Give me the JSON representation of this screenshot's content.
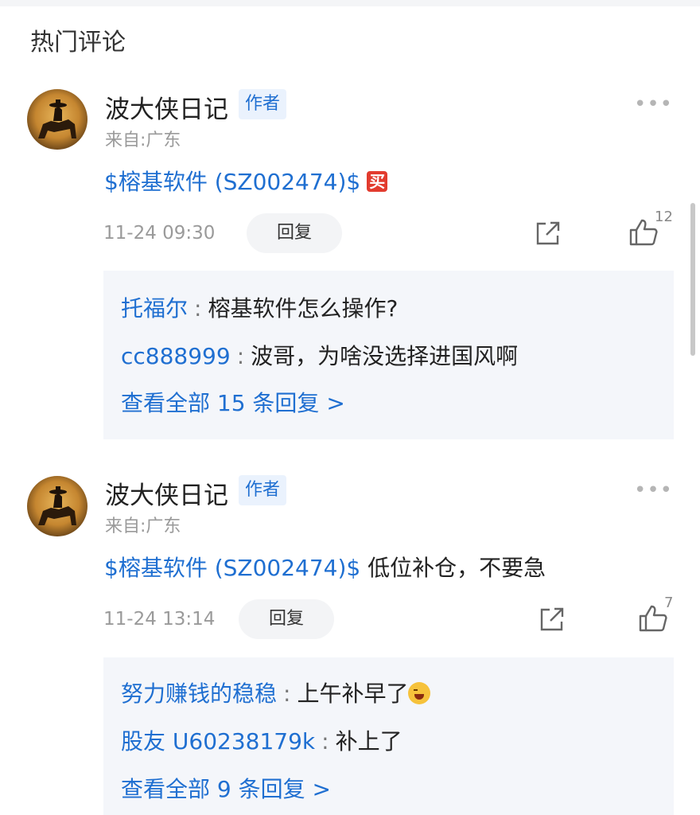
{
  "section_title": "热门评论",
  "comments": [
    {
      "username": "波大侠日记",
      "author_badge": "作者",
      "location": "来自:广东",
      "stock": "$榕基软件 (SZ002474)$",
      "text": "",
      "buy_tag": "买",
      "time": "11-24 09:30",
      "reply_label": "回复",
      "like_count": "12",
      "replies": [
        {
          "user": "托福尔",
          "sep": ":",
          "text": "榕基软件怎么操作?"
        },
        {
          "user": "cc888999",
          "sep": ":",
          "text": "波哥，为啥没选择进国风啊"
        }
      ],
      "view_all": "查看全部 15 条回复 >"
    },
    {
      "username": "波大侠日记",
      "author_badge": "作者",
      "location": "来自:广东",
      "stock": "$榕基软件 (SZ002474)$",
      "text": " 低位补仓，不要急",
      "time": "11-24 13:14",
      "reply_label": "回复",
      "like_count": "7",
      "replies": [
        {
          "user": "努力赚钱的稳稳",
          "sep": ":",
          "text": "上午补早了"
        },
        {
          "user": "股友 U60238179k",
          "sep": ":",
          "text": "补上了"
        }
      ],
      "view_all": "查看全部 9 条回复 >"
    }
  ],
  "icons": {
    "more": "more-dots-icon",
    "share": "share-icon",
    "like": "thumbs-up-icon",
    "emoji": "laughing-crying-emoji-icon"
  }
}
